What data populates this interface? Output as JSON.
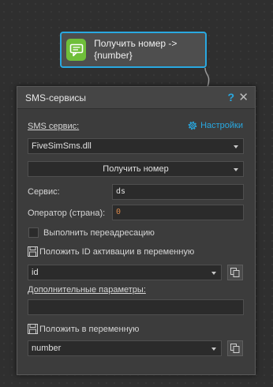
{
  "node": {
    "title": "Получить номер -> {number}",
    "icon": "chat-bubble-icon",
    "accent": "#29a8e0",
    "icon_bg": "#6fbf3a"
  },
  "dialog": {
    "title": "SMS-сервисы",
    "help_label": "?",
    "close_label": "✕",
    "sms_service_label": "SMS сервис:",
    "settings_label": "Настройки",
    "sms_service_value": "FiveSimSms.dll",
    "action_value": "Получить номер",
    "service_label": "Сервис:",
    "service_value": "ds",
    "operator_label": "Оператор (страна):",
    "operator_value": "0",
    "redirect_label": "Выполнить переадресацию",
    "activation_var_label": "Положить ID активации в переменную",
    "activation_var_value": "id",
    "extra_params_label": "Дополнительные параметры:",
    "extra_params_value": "",
    "result_var_label": "Положить в переменную",
    "result_var_value": "number"
  }
}
